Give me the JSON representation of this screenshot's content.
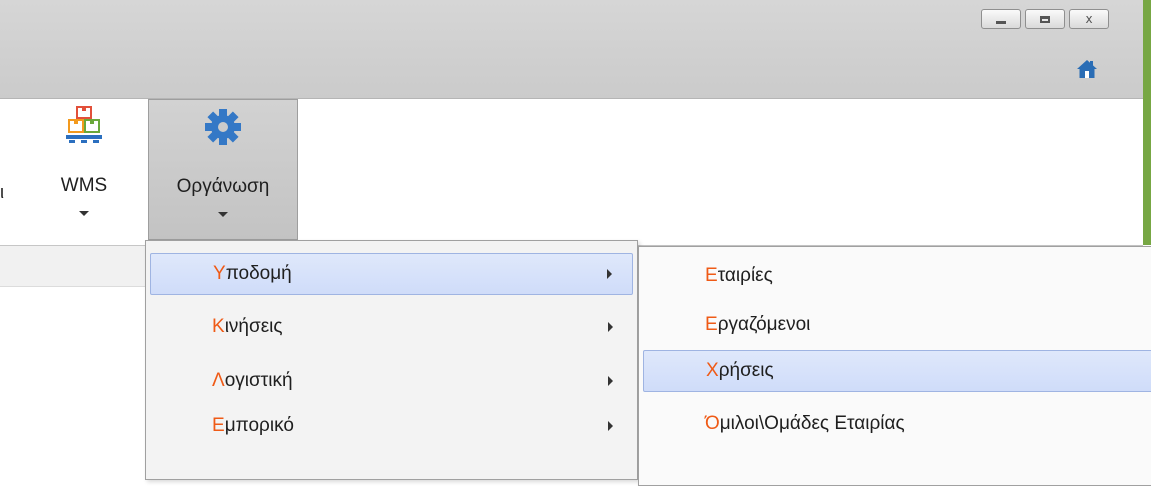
{
  "window": {
    "buttons": [
      {
        "name": "minimize-button",
        "glyph": ""
      },
      {
        "name": "maximize-button",
        "glyph": ""
      },
      {
        "name": "close-button",
        "glyph": "x"
      }
    ],
    "home_icon": "home-icon"
  },
  "ribbon": {
    "partial_label": "ι",
    "buttons": [
      {
        "label": "WMS",
        "icon": "warehouse-boxes-icon",
        "has_dropdown": true
      },
      {
        "label": "Οργάνωση",
        "icon": "gear-icon",
        "has_dropdown": true,
        "pressed": true
      }
    ]
  },
  "main_menu": {
    "items": [
      {
        "first": "Υ",
        "rest": "ποδομή",
        "highlighted": true,
        "has_submenu": true
      },
      {
        "first": "Κ",
        "rest": "ινήσεις",
        "highlighted": false,
        "has_submenu": true
      },
      {
        "first": "Λ",
        "rest": "ογιστική",
        "highlighted": false,
        "has_submenu": true
      },
      {
        "first": "Ε",
        "rest": "μπορικό",
        "highlighted": false,
        "has_submenu": true
      }
    ]
  },
  "sub_menu": {
    "items": [
      {
        "first": "Ε",
        "rest": "ταιρίες",
        "highlighted": false
      },
      {
        "first": "Ε",
        "rest": "ργαζόμενοι",
        "highlighted": false
      },
      {
        "first": "Χ",
        "rest": "ρήσεις",
        "highlighted": true
      },
      {
        "first": "Ό",
        "rest": "μιλοι\\Ομάδες Εταιρίας",
        "highlighted": false
      }
    ]
  },
  "colors": {
    "accent_letter": "#ef5a16",
    "gear_blue": "#3478c6",
    "home_blue": "#2a6db5",
    "highlight_bg": "#d4e0fa",
    "green_edge": "#77a744"
  }
}
